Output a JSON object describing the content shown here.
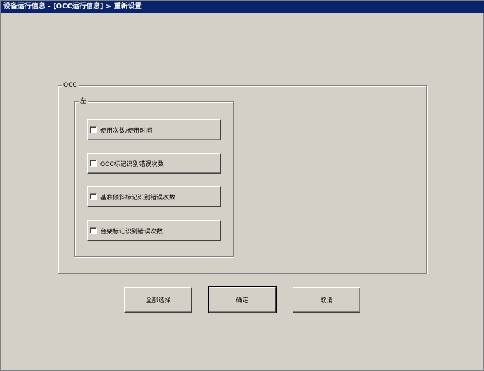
{
  "window": {
    "title": "设备运行信息 - [OCC运行信息] > 重新设置"
  },
  "occ_group": {
    "legend": "OCC"
  },
  "left_group": {
    "legend": "左",
    "options": [
      {
        "label": "使用次数/使用时间",
        "checked": false
      },
      {
        "label": "OCC标记识别错误次数",
        "checked": false
      },
      {
        "label": "基准倾斜标记识别错误次数",
        "checked": false
      },
      {
        "label": "台架标记识别错误次数",
        "checked": false
      }
    ]
  },
  "buttons": {
    "select_all": "全部选择",
    "ok": "确定",
    "cancel": "取消"
  }
}
